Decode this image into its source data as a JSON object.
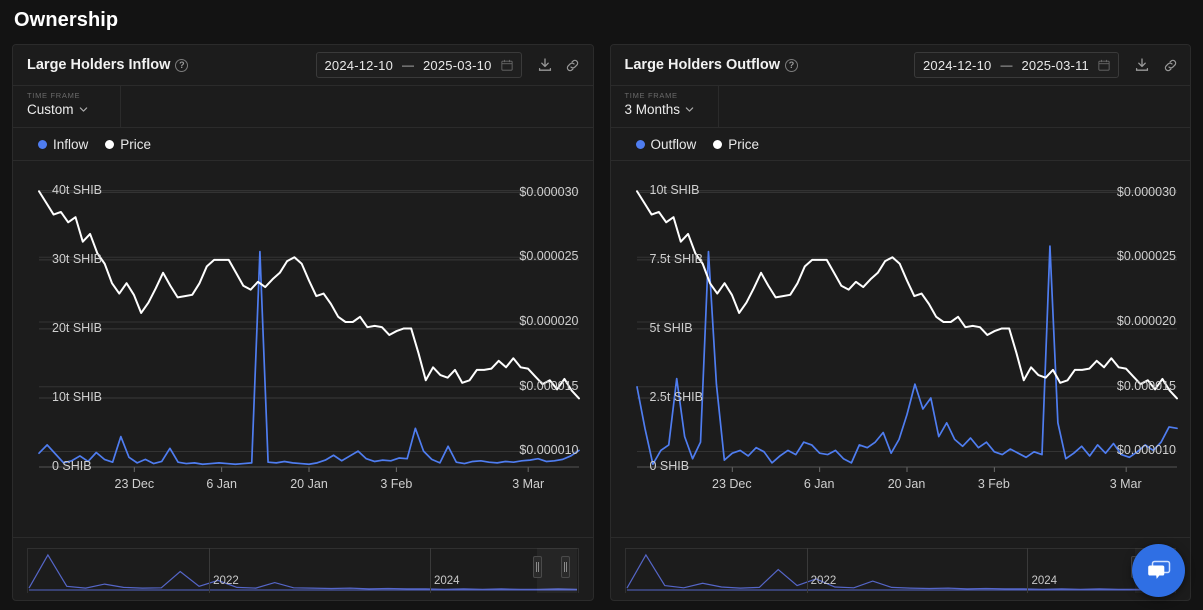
{
  "page": {
    "title": "Ownership"
  },
  "colors": {
    "flow_series": "#4f7df0",
    "price_series": "#ffffff",
    "accent": "#2f6fe4",
    "panel_bg": "#1c1c1c",
    "page_bg": "#131313",
    "grid": "#3a3a3a"
  },
  "panels": [
    {
      "id": "inflow",
      "title": "Large Holders Inflow",
      "info_icon": "info-icon",
      "date_start": "2024-12-10",
      "date_end": "2025-03-10",
      "date_dash": "—",
      "calendar_icon": "calendar-icon",
      "download_icon": "download-icon",
      "link_icon": "link-icon",
      "timeframe_label": "TIME FRAME",
      "timeframe_value": "Custom",
      "chevron_icon": "chevron-down-icon",
      "legend": [
        {
          "label": "Inflow",
          "color": "#4f7df0"
        },
        {
          "label": "Price",
          "color": "#ffffff"
        }
      ],
      "navigator": {
        "years": [
          "2022",
          "2024"
        ],
        "handle_left_icon": "drag-handle-icon",
        "handle_right_icon": "drag-handle-icon"
      },
      "chart_data": {
        "type": "line",
        "title": "Large Holders Inflow",
        "xlabel": "",
        "ylabel": "SHIB",
        "y2label": "Price",
        "grid": true,
        "legend_position": "top-left",
        "x_ticks": [
          "23 Dec",
          "6 Jan",
          "20 Jan",
          "3 Feb",
          "3 Mar"
        ],
        "x_tick_positions": [
          0.1765,
          0.3382,
          0.5,
          0.6618,
          0.9059
        ],
        "y_ticks": [
          "0 SHIB",
          "10t SHIB",
          "20t SHIB",
          "30t SHIB",
          "40t SHIB"
        ],
        "y_tick_values": [
          0,
          10,
          20,
          30,
          40
        ],
        "ylim": [
          0,
          42
        ],
        "y2_ticks": [
          "$0.000010",
          "$0.000015",
          "$0.000020",
          "$0.000025",
          "$0.000030"
        ],
        "y2_tick_values": [
          1e-05,
          1.5e-05,
          2e-05,
          2.5e-05,
          3e-05
        ],
        "y2lim": [
          8.8e-06,
          3.12e-05
        ],
        "series": [
          {
            "name": "Inflow",
            "color": "#4f7df0",
            "axis": "left",
            "values": [
              2.0,
              3.2,
              1.9,
              0.6,
              0.9,
              1.6,
              0.8,
              2.1,
              1.1,
              0.7,
              4.4,
              1.4,
              0.6,
              1.1,
              0.5,
              0.8,
              2.7,
              0.7,
              0.5,
              0.6,
              0.4,
              0.5,
              0.6,
              0.5,
              0.4,
              0.5,
              0.6,
              31.2,
              0.7,
              0.6,
              0.8,
              0.6,
              0.5,
              0.4,
              0.6,
              1.0,
              1.7,
              0.9,
              1.6,
              2.3,
              1.2,
              0.8,
              1.0,
              0.9,
              1.3,
              1.2,
              5.6,
              2.3,
              1.1,
              0.6,
              3.0,
              0.7,
              0.5,
              0.8,
              0.9,
              0.7,
              0.6,
              0.8,
              0.7,
              0.9,
              1.0,
              1.2,
              0.8,
              0.9,
              1.1,
              1.6,
              2.4
            ]
          },
          {
            "name": "Price",
            "color": "#ffffff",
            "axis": "right",
            "values": [
              3.01e-05,
              2.92e-05,
              2.83e-05,
              2.85e-05,
              2.77e-05,
              2.81e-05,
              2.62e-05,
              2.68e-05,
              2.53e-05,
              2.45e-05,
              2.3e-05,
              2.22e-05,
              2.3e-05,
              2.21e-05,
              2.07e-05,
              2.15e-05,
              2.26e-05,
              2.38e-05,
              2.28e-05,
              2.19e-05,
              2.2e-05,
              2.21e-05,
              2.3e-05,
              2.43e-05,
              2.48e-05,
              2.48e-05,
              2.48e-05,
              2.38e-05,
              2.28e-05,
              2.25e-05,
              2.31e-05,
              2.27e-05,
              2.33e-05,
              2.38e-05,
              2.47e-05,
              2.5e-05,
              2.45e-05,
              2.32e-05,
              2.2e-05,
              2.22e-05,
              2.14e-05,
              2.04e-05,
              2e-05,
              2e-05,
              2.04e-05,
              1.96e-05,
              1.97e-05,
              1.96e-05,
              1.9e-05,
              1.93e-05,
              1.95e-05,
              1.95e-05,
              1.76e-05,
              1.55e-05,
              1.65e-05,
              1.59e-05,
              1.57e-05,
              1.63e-05,
              1.53e-05,
              1.55e-05,
              1.63e-05,
              1.63e-05,
              1.64e-05,
              1.7e-05,
              1.65e-05,
              1.72e-05,
              1.65e-05,
              1.64e-05,
              1.58e-05,
              1.52e-05,
              1.55e-05,
              1.48e-05,
              1.56e-05,
              1.47e-05,
              1.41e-05
            ]
          }
        ]
      }
    },
    {
      "id": "outflow",
      "title": "Large Holders Outflow",
      "info_icon": "info-icon",
      "date_start": "2024-12-10",
      "date_end": "2025-03-11",
      "date_dash": "—",
      "calendar_icon": "calendar-icon",
      "download_icon": "download-icon",
      "link_icon": "link-icon",
      "timeframe_label": "TIME FRAME",
      "timeframe_value": "3 Months",
      "chevron_icon": "chevron-down-icon",
      "legend": [
        {
          "label": "Outflow",
          "color": "#4f7df0"
        },
        {
          "label": "Price",
          "color": "#ffffff"
        }
      ],
      "navigator": {
        "years": [
          "2022",
          "2024"
        ],
        "handle_left_icon": "drag-handle-icon",
        "handle_right_icon": "drag-handle-icon"
      },
      "chart_data": {
        "type": "line",
        "title": "Large Holders Outflow",
        "xlabel": "",
        "ylabel": "SHIB",
        "y2label": "Price",
        "grid": true,
        "legend_position": "top-left",
        "x_ticks": [
          "23 Dec",
          "6 Jan",
          "20 Jan",
          "3 Feb",
          "3 Mar"
        ],
        "x_tick_positions": [
          0.1765,
          0.3382,
          0.5,
          0.6618,
          0.9059
        ],
        "y_ticks": [
          "0 SHIB",
          "2.5t SHIB",
          "5t SHIB",
          "7.5t SHIB",
          "10t SHIB"
        ],
        "y_tick_values": [
          0,
          2.5,
          5,
          7.5,
          10
        ],
        "ylim": [
          0,
          10.5
        ],
        "y2_ticks": [
          "$0.000010",
          "$0.000015",
          "$0.000020",
          "$0.000025",
          "$0.000030"
        ],
        "y2_tick_values": [
          1e-05,
          1.5e-05,
          2e-05,
          2.5e-05,
          3e-05
        ],
        "y2lim": [
          8.8e-06,
          3.12e-05
        ],
        "series": [
          {
            "name": "Outflow",
            "color": "#4f7df0",
            "axis": "left",
            "values": [
              2.9,
              1.4,
              0.1,
              0.6,
              0.8,
              3.2,
              1.1,
              0.3,
              0.9,
              7.8,
              3.0,
              0.25,
              0.5,
              0.6,
              0.4,
              0.7,
              0.55,
              0.15,
              0.4,
              0.6,
              0.45,
              0.9,
              0.8,
              0.5,
              0.45,
              0.6,
              0.3,
              0.15,
              0.8,
              0.7,
              0.9,
              1.25,
              0.5,
              1.0,
              1.9,
              3.0,
              2.1,
              2.5,
              1.1,
              1.6,
              1.0,
              0.75,
              1.05,
              0.7,
              0.9,
              0.55,
              0.45,
              0.65,
              0.5,
              0.35,
              0.55,
              0.45,
              8.0,
              1.6,
              0.3,
              0.5,
              0.75,
              0.4,
              0.8,
              0.5,
              0.85,
              0.45,
              0.35,
              0.55,
              0.8,
              0.6,
              0.9,
              1.45,
              1.4
            ]
          },
          {
            "name": "Price",
            "color": "#ffffff",
            "axis": "right",
            "values": [
              3.01e-05,
              2.92e-05,
              2.83e-05,
              2.85e-05,
              2.77e-05,
              2.81e-05,
              2.62e-05,
              2.68e-05,
              2.53e-05,
              2.45e-05,
              2.3e-05,
              2.22e-05,
              2.3e-05,
              2.21e-05,
              2.07e-05,
              2.15e-05,
              2.26e-05,
              2.38e-05,
              2.28e-05,
              2.19e-05,
              2.2e-05,
              2.21e-05,
              2.3e-05,
              2.43e-05,
              2.48e-05,
              2.48e-05,
              2.48e-05,
              2.38e-05,
              2.28e-05,
              2.25e-05,
              2.31e-05,
              2.27e-05,
              2.33e-05,
              2.38e-05,
              2.47e-05,
              2.5e-05,
              2.45e-05,
              2.32e-05,
              2.2e-05,
              2.22e-05,
              2.14e-05,
              2.04e-05,
              2e-05,
              2e-05,
              2.04e-05,
              1.96e-05,
              1.97e-05,
              1.96e-05,
              1.9e-05,
              1.93e-05,
              1.95e-05,
              1.95e-05,
              1.76e-05,
              1.55e-05,
              1.65e-05,
              1.59e-05,
              1.57e-05,
              1.63e-05,
              1.53e-05,
              1.55e-05,
              1.63e-05,
              1.63e-05,
              1.64e-05,
              1.7e-05,
              1.65e-05,
              1.72e-05,
              1.65e-05,
              1.64e-05,
              1.58e-05,
              1.52e-05,
              1.55e-05,
              1.48e-05,
              1.56e-05,
              1.47e-05,
              1.41e-05
            ]
          }
        ],
        "navigator_series": [
          0.05,
          0.95,
          0.12,
          0.06,
          0.18,
          0.08,
          0.05,
          0.07,
          0.55,
          0.12,
          0.3,
          0.08,
          0.06,
          0.24,
          0.07,
          0.05,
          0.04,
          0.05,
          0.03,
          0.04,
          0.03,
          0.03,
          0.02,
          0.03,
          0.02,
          0.03,
          0.02,
          0.02,
          0.03,
          0.02
        ]
      }
    }
  ],
  "chat_widget": {
    "icon": "chat-bubble-icon",
    "color": "#2f6fe4"
  }
}
